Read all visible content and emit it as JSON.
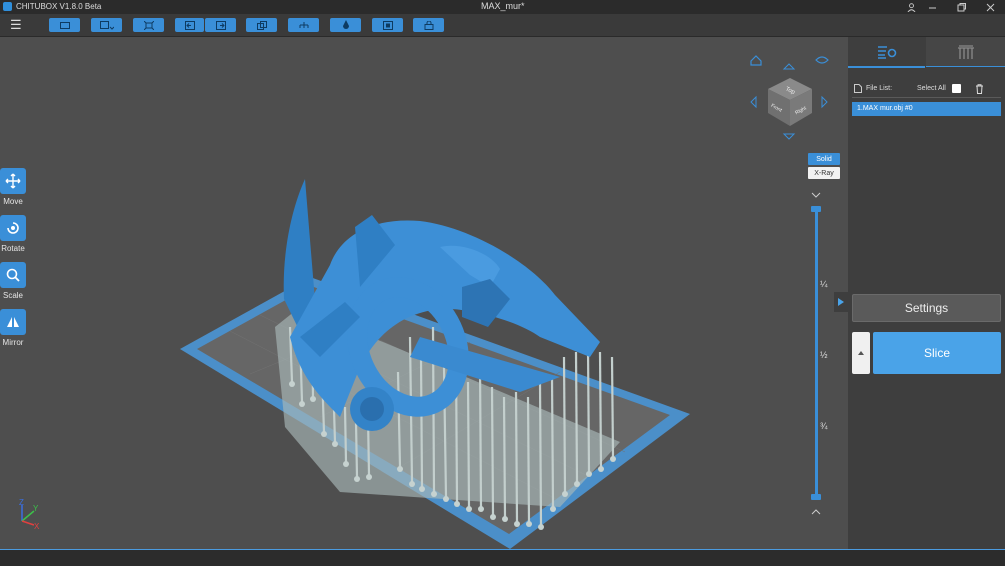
{
  "titlebar": {
    "app_title": "CHITUBOX V1.8.0 Beta",
    "document_title": "MAX_mur*"
  },
  "left_tools": [
    {
      "label": "Move",
      "icon": "move-icon"
    },
    {
      "label": "Rotate",
      "icon": "rotate-icon"
    },
    {
      "label": "Scale",
      "icon": "scale-icon"
    },
    {
      "label": "Mirror",
      "icon": "mirror-icon"
    }
  ],
  "view": {
    "solid_label": "Solid",
    "xray_label": "X-Ray",
    "cube_top": "Top",
    "cube_front": "Front",
    "cube_right": "Right"
  },
  "slider": {
    "marks": [
      "¼",
      "½",
      "¾"
    ]
  },
  "axes": {
    "x": "X",
    "y": "Y",
    "z": "Z"
  },
  "file_panel": {
    "file_list_label": "File List:",
    "select_all_label": "Select All",
    "files": [
      "1.MAX mur.obj #0"
    ]
  },
  "actions": {
    "settings_label": "Settings",
    "slice_label": "Slice"
  },
  "colors": {
    "accent": "#3a8fd8",
    "model": "#3d8fd6",
    "supports": "#b9c7c6",
    "plate": "#6b6b6b"
  }
}
